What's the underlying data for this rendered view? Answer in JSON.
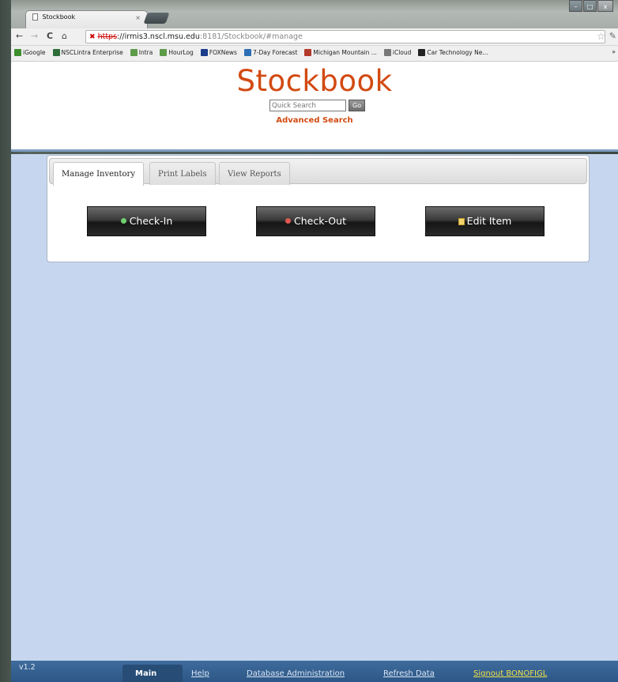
{
  "browser": {
    "tab_title": "Stockbook",
    "tab_close": "×",
    "window_controls": [
      "–",
      "□",
      "x"
    ],
    "nav": {
      "back": "←",
      "forward": "→",
      "reload": "C",
      "home": "⌂"
    },
    "url": {
      "scheme": "https",
      "host": "://irmis3.nscl.msu.edu",
      "rest": ":8181/Stockbook/#manage"
    },
    "bookmarks": [
      {
        "label": "iGoogle",
        "color": "#3d8f2e"
      },
      {
        "label": "NSCLintra Enterprise",
        "color": "#2f6d3b"
      },
      {
        "label": "Intra",
        "color": "#5d9b49"
      },
      {
        "label": "HourLog",
        "color": "#5d9b49"
      },
      {
        "label": "FOXNews",
        "color": "#1a3c8a"
      },
      {
        "label": "7-Day Forecast",
        "color": "#2c6fb6"
      },
      {
        "label": "Michigan Mountain ...",
        "color": "#b33a2b"
      },
      {
        "label": "iCloud",
        "color": "#777777"
      },
      {
        "label": "Car Technology Ne...",
        "color": "#222222"
      }
    ],
    "bookmarks_more": "»"
  },
  "header": {
    "title": "Stockbook",
    "quick_search_placeholder": "Quick Search",
    "go_label": "Go",
    "advanced_search": "Advanced Search"
  },
  "tabs": [
    {
      "label": "Manage Inventory",
      "active": true
    },
    {
      "label": "Print Labels",
      "active": false
    },
    {
      "label": "View Reports",
      "active": false
    }
  ],
  "actions": [
    {
      "label": "Check-In",
      "icon": "green-dot-icon",
      "color": "#6fd06f"
    },
    {
      "label": "Check-Out",
      "icon": "red-dot-icon",
      "color": "#e05a4f"
    },
    {
      "label": "Edit Item",
      "icon": "edit-icon",
      "color": "#f3d36b"
    }
  ],
  "footer": {
    "version": "v1.2",
    "links": [
      "Main",
      "Help",
      "Database Administration",
      "Refresh Data",
      "Signout BONOFIGL"
    ]
  }
}
